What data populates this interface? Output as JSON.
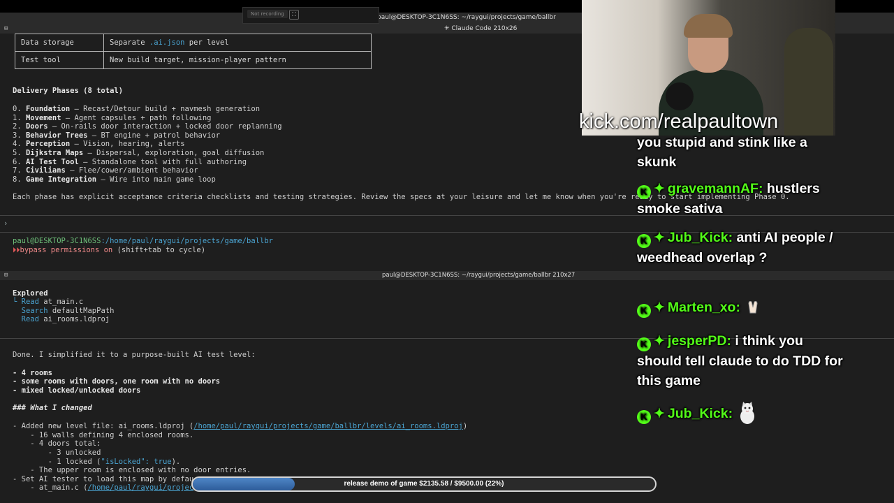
{
  "recorder": {
    "status": "Not recording",
    "fullscreen_icon": "expand-icon"
  },
  "pane1": {
    "title": "paul@DESKTOP-3C1N6SS: ~/raygui/projects/game/ballbr",
    "subtitle": "✳ Claude Code 210x26",
    "table": [
      [
        "Data storage",
        "Separate ",
        ".ai.json",
        " per level"
      ],
      [
        "Test tool",
        "New build target, mission-player pattern",
        "",
        ""
      ]
    ],
    "phases_heading": "Delivery Phases (8 total)",
    "phases": [
      {
        "num": "0. ",
        "name": "Foundation",
        "desc": " — Recast/Detour build + navmesh generation"
      },
      {
        "num": "1. ",
        "name": "Movement",
        "desc": " — Agent capsules + path following"
      },
      {
        "num": "2. ",
        "name": "Doors",
        "desc": " — On-rails door interaction + locked door replanning"
      },
      {
        "num": "3. ",
        "name": "Behavior Trees",
        "desc": " — BT engine + patrol behavior"
      },
      {
        "num": "4. ",
        "name": "Perception",
        "desc": " — Vision, hearing, alerts"
      },
      {
        "num": "5. ",
        "name": "Dijkstra Maps",
        "desc": " — Dispersal, exploration, goal diffusion"
      },
      {
        "num": "6. ",
        "name": "AI Test Tool",
        "desc": " — Standalone tool with full authoring"
      },
      {
        "num": "7. ",
        "name": "Civilians",
        "desc": " — Flee/cower/ambient behavior"
      },
      {
        "num": "8. ",
        "name": "Game Integration",
        "desc": " — Wire into main game loop"
      }
    ],
    "closing": "Each phase has explicit acceptance criteria checklists and testing strategies. Review the specs at your leisure and let me know when you're ready to start implementing Phase 0.",
    "prompt_char": "›",
    "prompt_user": "paul@DESKTOP-3C1N6SS",
    "prompt_path": ":/home/paul/raygui/projects/game/ballbr",
    "bypass_mark": "⏵⏵",
    "bypass_text": "bypass permissions on",
    "bypass_hint": " (shift+tab to cycle)"
  },
  "pane2": {
    "title": "paul@DESKTOP-3C1N6SS: ~/raygui/projects/game/ballbr 210x27",
    "explored": "Explored",
    "explored_items": [
      {
        "verb": "└ Read ",
        "target": "at_main.c"
      },
      {
        "verb": "  Search ",
        "target": "defaultMapPath"
      },
      {
        "verb": "  Read ",
        "target": "ai_rooms.ldproj"
      }
    ],
    "done": "Done. I simplified it to a purpose-built AI test level:",
    "bullets": [
      "- 4 rooms",
      "- some rooms with doors, one room with no doors",
      "- mixed locked/unlocked doors"
    ],
    "changed_heading": "### What I changed",
    "change1_pre": "- Added new level file: ai_rooms.ldproj (",
    "change1_link": "/home/paul/raygui/projects/game/ballbr/levels/ai_rooms.ldproj",
    "change1_post": ")",
    "sub": [
      "    - 16 walls defining 4 enclosed rooms.",
      "    - 4 doors total:",
      "        - 3 unlocked",
      "        - 1 locked (",
      "    - The upper room is enclosed with no door entries.",
      "- Set AI tester to load this map by defau",
      "    - at_main.c ("
    ],
    "locked_code": "\"isLocked\": true",
    "locked_post": ").",
    "last_link": "/home/paul/raygui/projec"
  },
  "overlay": {
    "channel": "kick.com/realpaultown",
    "chat": [
      {
        "user": "",
        "msg": "you stupid and stink like a skunk"
      },
      {
        "user": "gravemannAF:",
        "msg": "hustlers smoke sativa"
      },
      {
        "user": "Jub_Kick:",
        "msg": "anti AI people / weedhead overlap ?"
      },
      {
        "user": "Marten_xo:",
        "msg": "",
        "emote": "praying-hands-emote"
      },
      {
        "user": "jesperPD:",
        "msg": "i think you should tell claude to do TDD for this game"
      },
      {
        "user": "Jub_Kick:",
        "msg": "",
        "emote": "cat-emote"
      }
    ],
    "badge_letter": "K",
    "badge_icon": "kick-badge-icon",
    "diamond_glyph": "✦",
    "progress_label": "release demo of game $2135.58 / $9500.00 (22%)",
    "progress_fraction": 0.22,
    "colors": {
      "kick_green": "#53fc18",
      "progress_blue": "#4f86c6"
    }
  }
}
